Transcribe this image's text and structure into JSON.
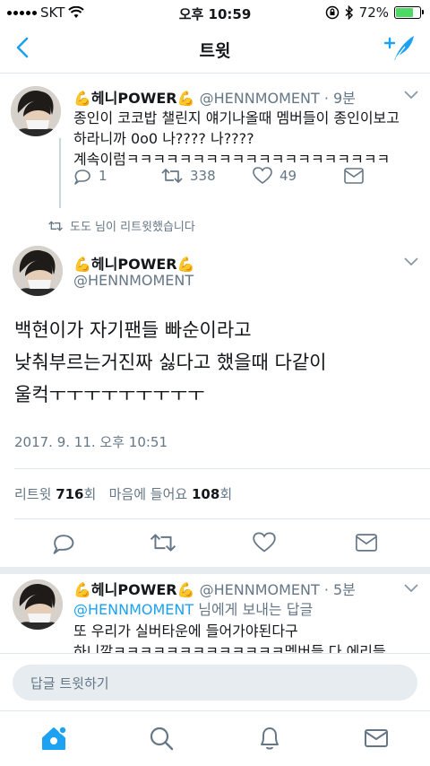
{
  "status_bar": {
    "carrier": "SKT",
    "time": "오후 10:59",
    "battery": "72%",
    "battery_level": 0.72
  },
  "nav": {
    "title": "트윗"
  },
  "prev_tweet": {
    "name": "헤니POWER",
    "handle": "@HENNMOMENT · 9분",
    "lines": [
      "종인이 코코밥 챌린지 얘기나올때 멤버들이 종인이보고",
      "하라니까 0o0 나???? 나????",
      "계속이럼ㅋㅋㅋㅋㅋㅋㅋㅋㅋㅋㅋㅋㅋㅋㅋㅋㅋㅋㅋㅋ"
    ],
    "reply_count": "1",
    "retweet_count": "338",
    "like_count": "49"
  },
  "retweet_context": "도도 님이 리트윗했습니다",
  "main_tweet": {
    "name": "헤니POWER",
    "handle": "@HENNMOMENT",
    "lines": [
      "백현이가 자기팬들 빠순이라고",
      "낮춰부르는거진짜 싫다고 했을때 다같이",
      "울컥ㅜㅜㅜㅜㅜㅜㅜㅜㅜ"
    ],
    "timestamp": "2017. 9. 11. 오후 10:51",
    "retweets_label": "리트윗",
    "retweets_count": "716",
    "retweets_unit": "회",
    "likes_label": "마음에 들어요",
    "likes_count": "108",
    "likes_unit": "회"
  },
  "reply_tweet": {
    "name": "헤니POWER",
    "handle": "@HENNMOMENT · 5분",
    "reply_to_mention": "@HENNMOMENT",
    "reply_to_suffix": " 님에게 보내는 답글",
    "lines": [
      "또 우리가 실버타운에 들어가야된다구",
      "하니깔ㅋㅋㅋㅋㅋㅋㅋㅋㅋㅋㅋㅋㅋ멤버들 다 에리들"
    ]
  },
  "reply_bar": {
    "placeholder": "답글 트윗하기"
  },
  "colors": {
    "accent": "#1da1f2",
    "secondary_text": "#657786",
    "divider": "#e1e8ed",
    "battery_fill": "#4cd964"
  },
  "icons": {
    "emoji": "💪"
  }
}
